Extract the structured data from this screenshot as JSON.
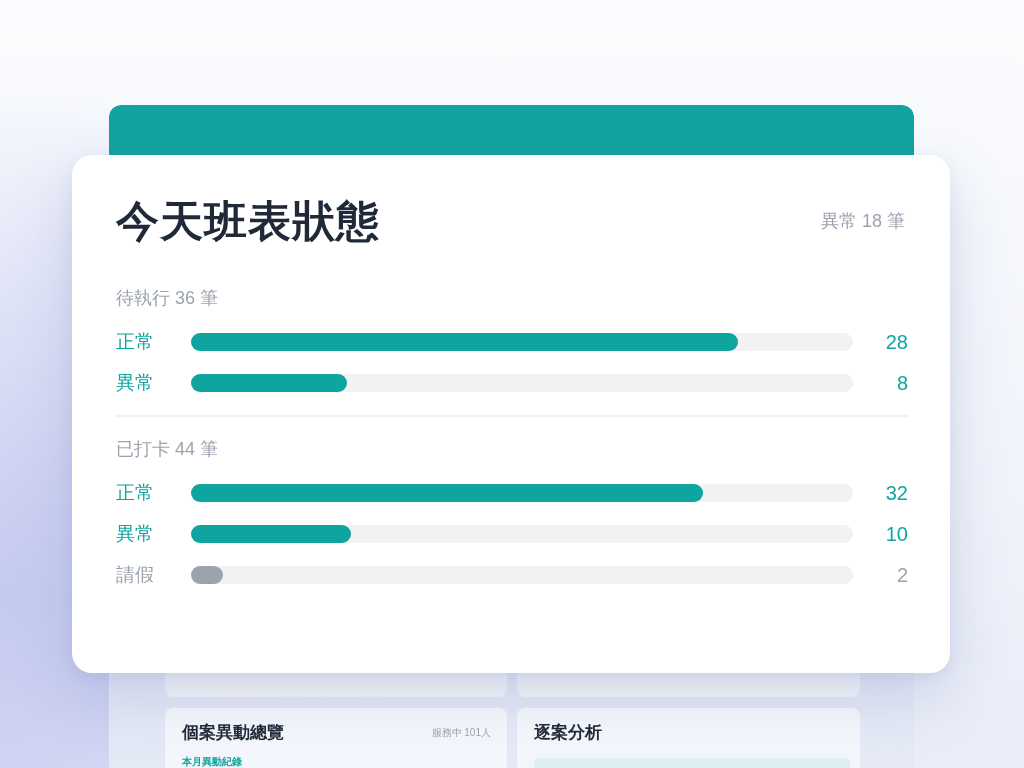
{
  "status_card": {
    "title": "今天班表狀態",
    "summary": "異常 18 筆",
    "sections": [
      {
        "label": "待執行 36 筆",
        "rows": [
          {
            "label": "正常",
            "value": "28",
            "level": 0.826,
            "color": "#0ea5a0"
          },
          {
            "label": "異常",
            "value": "8",
            "level": 0.236,
            "color": "#0ea5a0"
          }
        ]
      },
      {
        "label": "已打卡 44 筆",
        "rows": [
          {
            "label": "正常",
            "value": "32",
            "level": 0.773,
            "color": "#0ea5a0"
          },
          {
            "label": "異常",
            "value": "10",
            "level": 0.242,
            "color": "#0ea5a0"
          },
          {
            "label": "請假",
            "value": "2",
            "level": 0.048,
            "color": "#9ca3af"
          }
        ]
      }
    ]
  },
  "background_dashboard": {
    "cards": [
      {
        "title": "個案異動總覽",
        "meta": "服務中 101人",
        "subheading": "本月異動紀錄"
      },
      {
        "title": "逐案分析"
      }
    ]
  }
}
